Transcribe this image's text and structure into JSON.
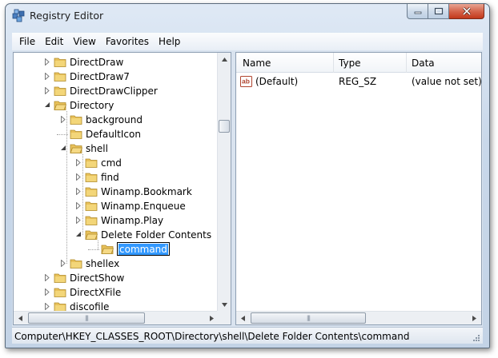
{
  "window": {
    "title": "Registry Editor"
  },
  "menu": [
    "File",
    "Edit",
    "View",
    "Favorites",
    "Help"
  ],
  "tree": {
    "items": [
      {
        "label": "DirectDraw",
        "state": "closed"
      },
      {
        "label": "DirectDraw7",
        "state": "closed"
      },
      {
        "label": "DirectDrawClipper",
        "state": "closed"
      },
      {
        "label": "Directory",
        "state": "open"
      },
      {
        "label": "background",
        "state": "closed"
      },
      {
        "label": "DefaultIcon",
        "state": "none"
      },
      {
        "label": "shell",
        "state": "open"
      },
      {
        "label": "cmd",
        "state": "closed"
      },
      {
        "label": "find",
        "state": "closed"
      },
      {
        "label": "Winamp.Bookmark",
        "state": "closed"
      },
      {
        "label": "Winamp.Enqueue",
        "state": "closed"
      },
      {
        "label": "Winamp.Play",
        "state": "closed"
      },
      {
        "label": "Delete Folder Contents",
        "state": "open"
      },
      {
        "label": "command",
        "state": "editing"
      },
      {
        "label": "shellex",
        "state": "closed"
      },
      {
        "label": "DirectShow",
        "state": "closed"
      },
      {
        "label": "DirectXFile",
        "state": "closed"
      },
      {
        "label": "discofile",
        "state": "closed"
      }
    ]
  },
  "list": {
    "columns": [
      "Name",
      "Type",
      "Data"
    ],
    "rows": [
      {
        "name": "(Default)",
        "type": "REG_SZ",
        "data": "(value not set)",
        "icon": "string-value-icon"
      }
    ]
  },
  "status": {
    "path": "Computer\\HKEY_CLASSES_ROOT\\Directory\\shell\\Delete Folder Contents\\command"
  },
  "colors": {
    "selection": "#3399ff",
    "folder": "#e8c15a"
  }
}
